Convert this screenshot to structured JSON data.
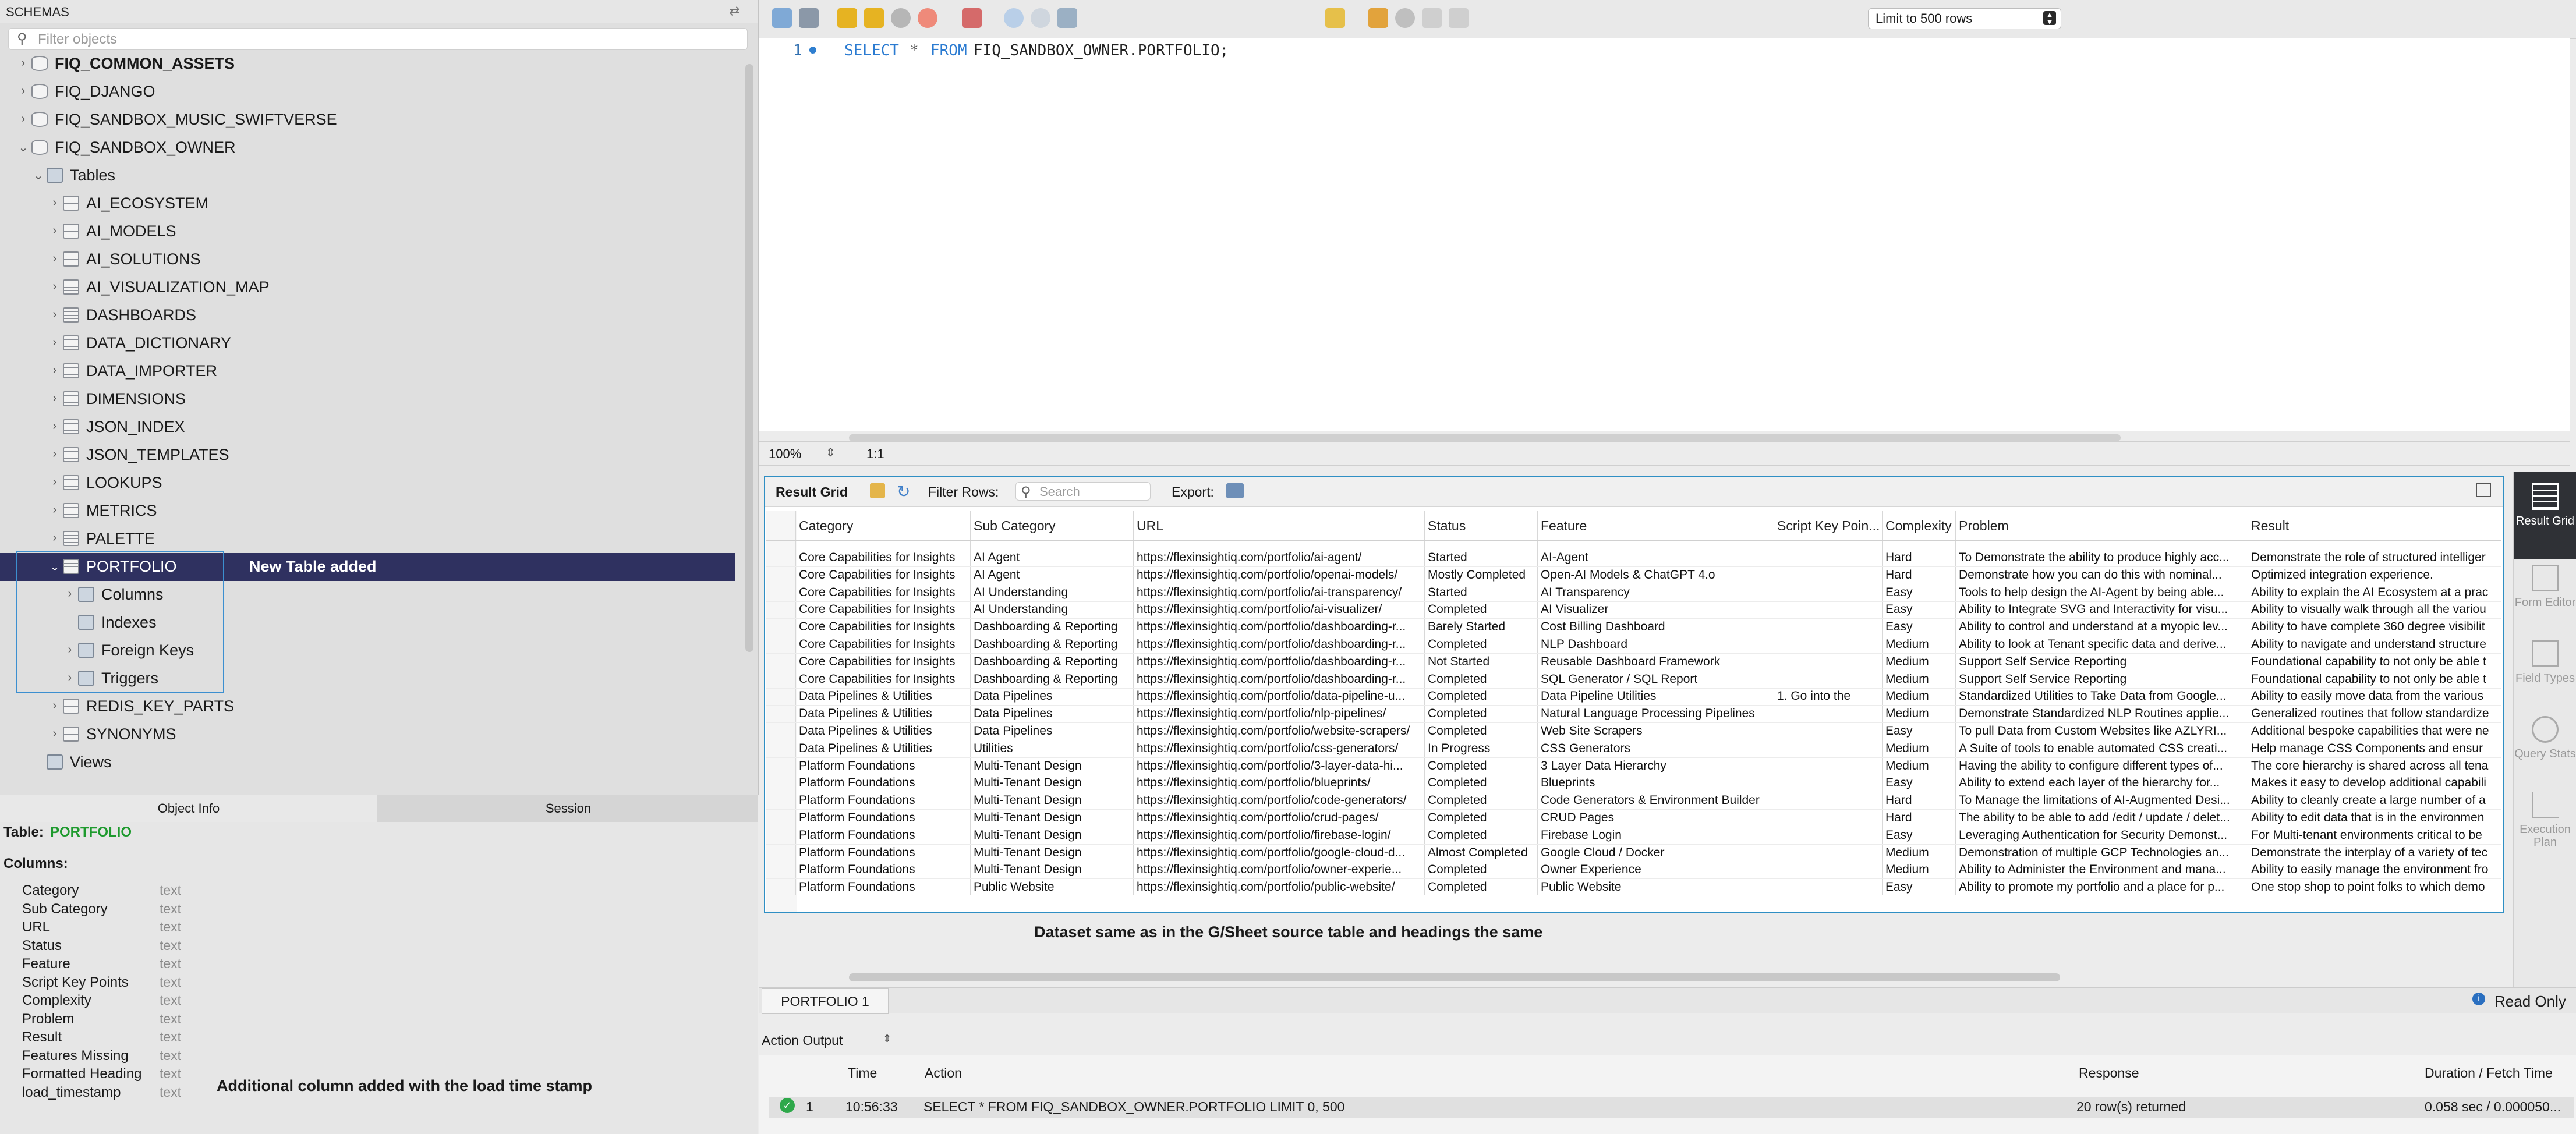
{
  "sidebar": {
    "title": "SCHEMAS",
    "filter_placeholder": "Filter objects",
    "items": [
      {
        "label": "FIQ_COMMON_ASSETS",
        "level": 0,
        "bold": true,
        "icon": "database-icon"
      },
      {
        "label": "FIQ_DJANGO",
        "level": 0,
        "icon": "database-icon"
      },
      {
        "label": "FIQ_SANDBOX_MUSIC_SWIFTVERSE",
        "level": 0,
        "icon": "database-icon"
      },
      {
        "label": "FIQ_SANDBOX_OWNER",
        "level": 0,
        "expanded": true,
        "icon": "database-icon"
      },
      {
        "label": "Tables",
        "level": 1,
        "expanded": true,
        "icon": "folder-icon"
      },
      {
        "label": "AI_ECOSYSTEM",
        "level": 2,
        "icon": "table-icon"
      },
      {
        "label": "AI_MODELS",
        "level": 2,
        "icon": "table-icon"
      },
      {
        "label": "AI_SOLUTIONS",
        "level": 2,
        "icon": "table-icon"
      },
      {
        "label": "AI_VISUALIZATION_MAP",
        "level": 2,
        "icon": "table-icon"
      },
      {
        "label": "DASHBOARDS",
        "level": 2,
        "icon": "table-icon"
      },
      {
        "label": "DATA_DICTIONARY",
        "level": 2,
        "icon": "table-icon"
      },
      {
        "label": "DATA_IMPORTER",
        "level": 2,
        "icon": "table-icon"
      },
      {
        "label": "DIMENSIONS",
        "level": 2,
        "icon": "table-icon"
      },
      {
        "label": "JSON_INDEX",
        "level": 2,
        "icon": "table-icon"
      },
      {
        "label": "JSON_TEMPLATES",
        "level": 2,
        "icon": "table-icon"
      },
      {
        "label": "LOOKUPS",
        "level": 2,
        "icon": "table-icon"
      },
      {
        "label": "METRICS",
        "level": 2,
        "icon": "table-icon"
      },
      {
        "label": "PALETTE",
        "level": 2,
        "icon": "table-icon"
      },
      {
        "label": "PORTFOLIO",
        "level": 2,
        "expanded": true,
        "selected": true,
        "icon": "table-icon"
      },
      {
        "label": "Columns",
        "level": 3,
        "icon": "folder-icon"
      },
      {
        "label": "Indexes",
        "level": 3,
        "no_chevron": true,
        "icon": "folder-icon"
      },
      {
        "label": "Foreign Keys",
        "level": 3,
        "icon": "folder-icon"
      },
      {
        "label": "Triggers",
        "level": 3,
        "icon": "folder-icon"
      },
      {
        "label": "REDIS_KEY_PARTS",
        "level": 2,
        "icon": "table-icon"
      },
      {
        "label": "SYNONYMS",
        "level": 2,
        "icon": "table-icon"
      },
      {
        "label": "Views",
        "level": 1,
        "no_chevron": true,
        "icon": "folder-icon"
      }
    ],
    "new_table_note": "New Table added"
  },
  "info_panel": {
    "tabs": [
      "Object Info",
      "Session"
    ],
    "table_prefix": "Table:",
    "table_name": "PORTFOLIO",
    "columns_label": "Columns:",
    "columns": [
      {
        "name": "Category",
        "type": "text"
      },
      {
        "name": "Sub Category",
        "type": "text"
      },
      {
        "name": "URL",
        "type": "text"
      },
      {
        "name": "Status",
        "type": "text"
      },
      {
        "name": "Feature",
        "type": "text"
      },
      {
        "name": "Script Key Points",
        "type": "text"
      },
      {
        "name": "Complexity",
        "type": "text"
      },
      {
        "name": "Problem",
        "type": "text"
      },
      {
        "name": "Result",
        "type": "text"
      },
      {
        "name": "Features Missing",
        "type": "text"
      },
      {
        "name": "Formatted Heading",
        "type": "text"
      },
      {
        "name": "load_timestamp",
        "type": "text"
      }
    ],
    "timestamp_note": "Additional column added with the load time stamp",
    "accent_color": "#1e9a2e"
  },
  "toolbar": {
    "limit_label": "Limit to 500 rows",
    "icons": [
      "open-folder-icon",
      "save-icon",
      "execute-icon",
      "execute-current-icon",
      "explain-icon",
      "stop-icon",
      "error-toggle-icon",
      "commit-icon",
      "rollback-icon",
      "autocommit-icon",
      "favorite-icon",
      "beautify-icon",
      "find-icon",
      "invisible-chars-icon",
      "wrap-icon"
    ]
  },
  "editor": {
    "line_number": "1",
    "sql_keyword1": "SELECT",
    "sql_star": "*",
    "sql_keyword2": "FROM",
    "sql_object": "FIQ_SANDBOX_OWNER.PORTFOLIO;",
    "zoom": "100%",
    "position": "1:1"
  },
  "result_grid": {
    "tab_label": "Result Grid",
    "filter_label": "Filter Rows:",
    "search_placeholder": "Search",
    "export_label": "Export:",
    "columns": [
      "Category",
      "Sub Category",
      "URL",
      "Status",
      "Feature",
      "Script Key Poin...",
      "Complexity",
      "Problem",
      "Result"
    ],
    "rows": [
      [
        "Core Capabilities for Insights",
        "AI Agent",
        "https://flexinsightiq.com/portfolio/ai-agent/",
        "Started",
        "AI-Agent",
        "",
        "Hard",
        "To Demonstrate the ability to produce highly acc...",
        "Demonstrate the role of structured intelliger"
      ],
      [
        "Core Capabilities for Insights",
        "AI Agent",
        "https://flexinsightiq.com/portfolio/openai-models/",
        "Mostly Completed",
        "Open-AI Models & ChatGPT 4.o",
        "",
        "Hard",
        "Demonstrate how you can do this with nominal...",
        "Optimized integration experience."
      ],
      [
        "Core Capabilities for Insights",
        "AI Understanding",
        "https://flexinsightiq.com/portfolio/ai-transparency/",
        "Started",
        "AI Transparency",
        "",
        "Easy",
        "Tools to help design the AI-Agent by being able...",
        "Ability to explain the AI Ecosystem at a prac"
      ],
      [
        "Core Capabilities for Insights",
        "AI Understanding",
        "https://flexinsightiq.com/portfolio/ai-visualizer/",
        "Completed",
        "AI Visualizer",
        "",
        "Easy",
        "Ability to Integrate SVG and Interactivity for visu...",
        "Ability to visually walk through all the variou"
      ],
      [
        "Core Capabilities for Insights",
        "Dashboarding & Reporting",
        "https://flexinsightiq.com/portfolio/dashboarding-r...",
        "Barely Started",
        "Cost Billing Dashboard",
        "",
        "Easy",
        "Ability to control and understand at a myopic lev...",
        "Ability to have complete 360 degree visibilit"
      ],
      [
        "Core Capabilities for Insights",
        "Dashboarding & Reporting",
        "https://flexinsightiq.com/portfolio/dashboarding-r...",
        "Completed",
        "NLP Dashboard",
        "",
        "Medium",
        "Ability to look at Tenant specific data and derive...",
        "Ability to navigate and understand structure"
      ],
      [
        "Core Capabilities for Insights",
        "Dashboarding & Reporting",
        "https://flexinsightiq.com/portfolio/dashboarding-r...",
        "Not Started",
        "Reusable Dashboard Framework",
        "",
        "Medium",
        "Support Self Service Reporting",
        "Foundational capability to not only be able t"
      ],
      [
        "Core Capabilities for Insights",
        "Dashboarding & Reporting",
        "https://flexinsightiq.com/portfolio/dashboarding-r...",
        "Completed",
        "SQL Generator / SQL Report",
        "",
        "Medium",
        "Support Self Service Reporting",
        "Foundational capability to not only be able t"
      ],
      [
        "Data Pipelines & Utilities",
        "Data Pipelines",
        "https://flexinsightiq.com/portfolio/data-pipeline-u...",
        "Completed",
        "Data Pipeline Utilities",
        "1. Go into the",
        "Medium",
        "Standardized Utilities to Take Data from Google...",
        "Ability to easily move data from the various"
      ],
      [
        "Data Pipelines & Utilities",
        "Data Pipelines",
        "https://flexinsightiq.com/portfolio/nlp-pipelines/",
        "Completed",
        "Natural Language Processing Pipelines",
        "",
        "Medium",
        "Demonstrate Standardized NLP Routines applie...",
        "Generalized routines that follow standardize"
      ],
      [
        "Data Pipelines & Utilities",
        "Data Pipelines",
        "https://flexinsightiq.com/portfolio/website-scrapers/",
        "Completed",
        "Web Site Scrapers",
        "",
        "Easy",
        "To pull Data from Custom Websites like AZLYRI...",
        "Additional bespoke capabilities that were ne"
      ],
      [
        "Data Pipelines & Utilities",
        "Utilities",
        "https://flexinsightiq.com/portfolio/css-generators/",
        "In Progress",
        "CSS Generators",
        "",
        "Medium",
        "A Suite of tools to enable automated CSS creati...",
        "Help manage CSS Components and ensur"
      ],
      [
        "Platform Foundations",
        "Multi-Tenant Design",
        "https://flexinsightiq.com/portfolio/3-layer-data-hi...",
        "Completed",
        "3 Layer Data Hierarchy",
        "",
        "Medium",
        "Having the ability to configure different types of...",
        "The core hierarchy is shared across all tena"
      ],
      [
        "Platform Foundations",
        "Multi-Tenant Design",
        "https://flexinsightiq.com/portfolio/blueprints/",
        "Completed",
        "Blueprints",
        "",
        "Easy",
        "Ability to extend each layer of the hierarchy for...",
        "Makes it easy to develop additional capabili"
      ],
      [
        "Platform Foundations",
        "Multi-Tenant Design",
        "https://flexinsightiq.com/portfolio/code-generators/",
        "Completed",
        "Code Generators & Environment Builder",
        "",
        "Hard",
        "To Manage the limitations of AI-Augmented Desi...",
        "Ability to cleanly create a large number of a"
      ],
      [
        "Platform Foundations",
        "Multi-Tenant Design",
        "https://flexinsightiq.com/portfolio/crud-pages/",
        "Completed",
        "CRUD Pages",
        "",
        "Hard",
        "The ability to be able to add /edit / update / delet...",
        "Ability to edit data that is in the environmen"
      ],
      [
        "Platform Foundations",
        "Multi-Tenant Design",
        "https://flexinsightiq.com/portfolio/firebase-login/",
        "Completed",
        "Firebase Login",
        "",
        "Easy",
        "Leveraging Authentication for Security Demonst...",
        "For Multi-tenant environments critical to be"
      ],
      [
        "Platform Foundations",
        "Multi-Tenant Design",
        "https://flexinsightiq.com/portfolio/google-cloud-d...",
        "Almost Completed",
        "Google Cloud / Docker",
        "",
        "Medium",
        "Demonstration of multiple GCP Technologies an...",
        "Demonstrate the interplay of a variety of tec"
      ],
      [
        "Platform Foundations",
        "Multi-Tenant Design",
        "https://flexinsightiq.com/portfolio/owner-experie...",
        "Completed",
        "Owner Experience",
        "",
        "Medium",
        "Ability to Administer the Environment and mana...",
        "Ability to easily manage the environment fro"
      ],
      [
        "Platform Foundations",
        "Public Website",
        "https://flexinsightiq.com/portfolio/public-website/",
        "Completed",
        "Public Website",
        "",
        "Easy",
        "Ability to promote my portfolio and a place for p...",
        "One stop shop to point folks to which demo"
      ]
    ],
    "dataset_note": "Dataset same as in the G/Sheet source table and headings the same",
    "result_tab": "PORTFOLIO 1",
    "read_only": "Read Only",
    "frame_color": "#2f8fc4"
  },
  "side_panel": {
    "items": [
      {
        "label": "Result Grid",
        "active": true
      },
      {
        "label": "Form Editor"
      },
      {
        "label": "Field Types"
      },
      {
        "label": "Query Stats"
      },
      {
        "label": "Execution Plan"
      }
    ]
  },
  "output": {
    "selector_label": "Action Output",
    "headers": [
      "Time",
      "Action",
      "Response",
      "Duration / Fetch Time"
    ],
    "rows": [
      {
        "index": "1",
        "time": "10:56:33",
        "action": "SELECT * FROM FIQ_SANDBOX_OWNER.PORTFOLIO LIMIT 0, 500",
        "response": "20 row(s) returned",
        "duration": "0.058 sec / 0.000050..."
      }
    ]
  }
}
